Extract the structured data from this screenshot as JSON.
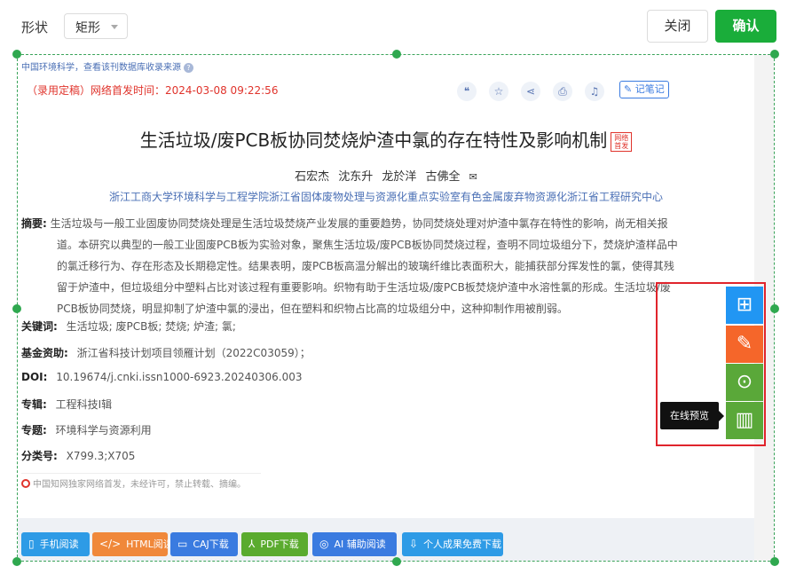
{
  "toolbar": {
    "shape_label": "形状",
    "shape_value": "矩形",
    "close_label": "关闭",
    "confirm_label": "确认",
    "confirm_color": "#1aad3a"
  },
  "article": {
    "source_line": "中国环境科学，查看该刊数据库收录来源",
    "pub_time": "（录用定稿）网络首发时间：2024-03-08 09:22:56",
    "note_button": "记笔记",
    "title": "生活垃圾/废PCB板协同焚烧炉渣中氯的存在特性及影响机制",
    "title_tag": "网络首发",
    "authors": "石宏杰   沈东升   龙於洋   古佛全",
    "affiliation": "浙江工商大学环境科学与工程学院浙江省固体废物处理与资源化重点实验室有色金属废弃物资源化浙江省工程研究中心",
    "abstract_label": "摘要:",
    "abstract_text": "生活垃圾与一般工业固废协同焚烧处理是生活垃圾焚烧产业发展的重要趋势，协同焚烧处理对炉渣中氯存在特性的影响，尚无相关报道。本研究以典型的一般工业固废PCB板为实验对象，聚焦生活垃圾/废PCB板协同焚烧过程，查明不同垃圾组分下，焚烧炉渣样品中的氯迁移行为、存在形态及长期稳定性。结果表明，废PCB板高温分解出的玻璃纤维比表面积大，能捕获部分挥发性的氯，使得其残留于炉渣中，但垃圾组分中塑料占比对该过程有重要影响。织物有助于生活垃圾/废PCB板焚烧炉渣中水溶性氯的形成。生活垃圾/废PCB板协同焚烧，明显抑制了炉渣中氯的浸出，但在塑料和织物占比高的垃圾组分中，这种抑制作用被削弱。",
    "keywords_label": "关键词:",
    "keywords": "生活垃圾;  废PCB板;  焚烧;  炉渣;  氯;",
    "fund_label": "基金资助:",
    "fund": "浙江省科技计划项目领雁计划（2022C03059）；",
    "doi_label": "DOI:",
    "doi": "10.19674/j.cnki.issn1000-6923.20240306.003",
    "album_label": "专辑:",
    "album": "工程科技Ⅰ辑",
    "topic_label": "专题:",
    "topic": "环境科学与资源利用",
    "class_label": "分类号:",
    "class_no": "X799.3;X705",
    "notice": "中国知网独家网络首发，未经许可，禁止转载、摘编。"
  },
  "downloads": [
    {
      "label": "手机阅读",
      "icon": "phone-icon",
      "color": "#2e9be6"
    },
    {
      "label": "HTML阅读",
      "icon": "code-icon",
      "color": "#f0883a"
    },
    {
      "label": "CAJ下载",
      "icon": "book-icon",
      "color": "#3a7be0"
    },
    {
      "label": "PDF下载",
      "icon": "pdf-icon",
      "color": "#5aab2e"
    },
    {
      "label": "AI 辅助阅读",
      "icon": "ai-icon",
      "color": "#3a7be0"
    },
    {
      "label": "个人成果免费下载",
      "icon": "download-icon",
      "color": "#2e9be6"
    }
  ],
  "sidebar": {
    "tooltip": "在线预览",
    "buttons": [
      {
        "icon": "apps-icon",
        "color": "#2196f3"
      },
      {
        "icon": "edit-question-icon",
        "color": "#f5662a"
      },
      {
        "icon": "download-circle-icon",
        "color": "#5aa839"
      },
      {
        "icon": "open-book-icon",
        "color": "#5aa839"
      }
    ]
  }
}
